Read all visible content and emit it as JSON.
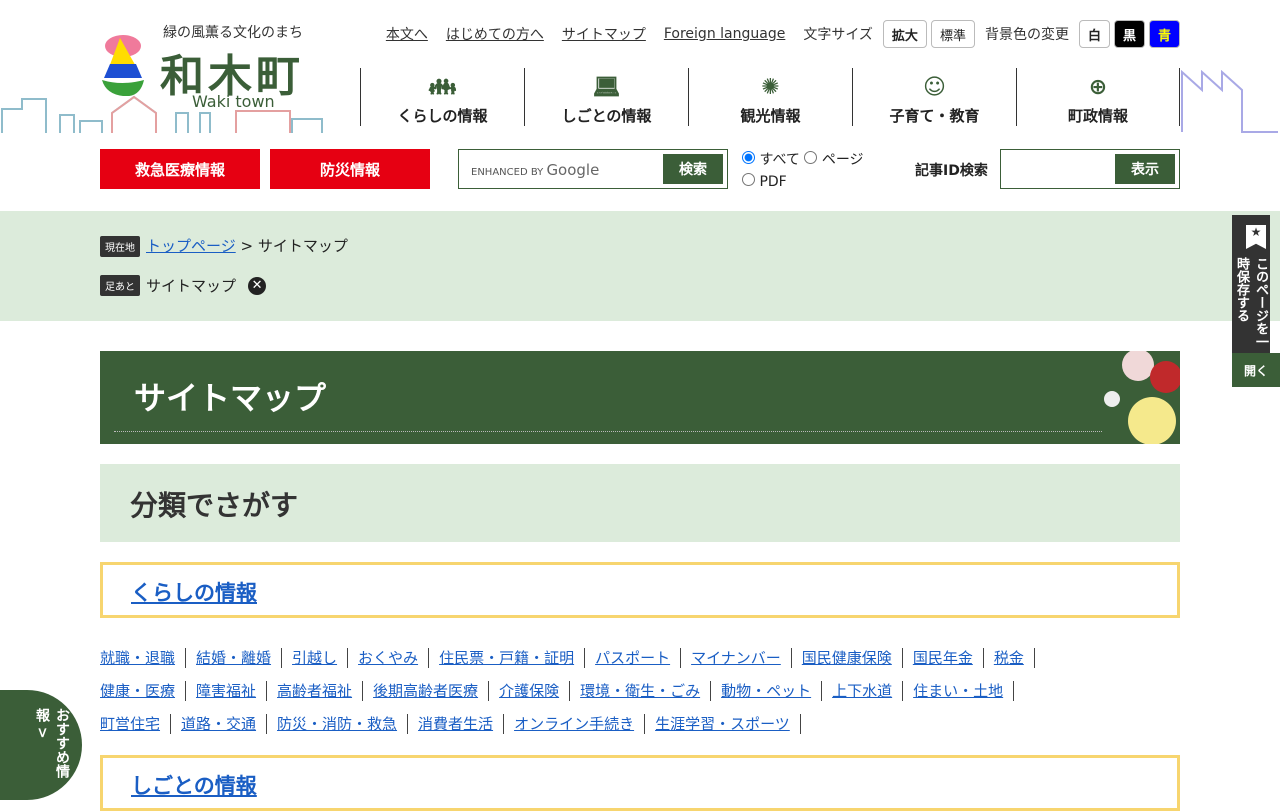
{
  "logo": {
    "tagline": "緑の風薫る文化のまち",
    "name": "和木町",
    "name_en": "Waki town"
  },
  "util": {
    "links": [
      "本文へ",
      "はじめての方へ",
      "サイトマップ",
      "Foreign language"
    ],
    "font_size_label": "文字サイズ",
    "font_enlarge": "拡大",
    "font_standard": "標準",
    "bg_label": "背景色の変更",
    "bg_white": "白",
    "bg_black": "黒",
    "bg_blue": "青"
  },
  "nav": [
    {
      "label": "くらしの情報",
      "icon": "family-icon"
    },
    {
      "label": "しごとの情報",
      "icon": "work-icon"
    },
    {
      "label": "観光情報",
      "icon": "fireworks-icon"
    },
    {
      "label": "子育て・教育",
      "icon": "child-icon"
    },
    {
      "label": "町政情報",
      "icon": "globe-icon"
    }
  ],
  "emergency": "救急医療情報",
  "disaster": "防災情報",
  "search": {
    "enhanced": "ENHANCED BY",
    "google": "Google",
    "button": "検索",
    "radios": [
      "すべて",
      "ページ",
      "PDF"
    ]
  },
  "article_id": {
    "label": "記事ID検索",
    "button": "表示"
  },
  "breadcrumb": {
    "badge": "現在地",
    "home": "トップページ",
    "sep": ">",
    "current": "サイトマップ"
  },
  "footprint": {
    "badge": "足あと",
    "item": "サイトマップ"
  },
  "side": {
    "save": "このページを一時保存する",
    "open": "開く"
  },
  "page_title": "サイトマップ",
  "section_title": "分類でさがす",
  "categories": [
    {
      "title": "くらしの情報",
      "links": [
        "就職・退職",
        "結婚・離婚",
        "引越し",
        "おくやみ",
        "住民票・戸籍・証明",
        "パスポート",
        "マイナンバー",
        "国民健康保険",
        "国民年金",
        "税金",
        "健康・医療",
        "障害福祉",
        "高齢者福祉",
        "後期高齢者医療",
        "介護保険",
        "環境・衛生・ごみ",
        "動物・ペット",
        "上下水道",
        "住まい・土地",
        "町営住宅",
        "道路・交通",
        "防災・消防・救急",
        "消費者生活",
        "オンライン手続き",
        "生涯学習・スポーツ"
      ]
    },
    {
      "title": "しごとの情報"
    }
  ],
  "osusume": "おすすめ情報 >"
}
